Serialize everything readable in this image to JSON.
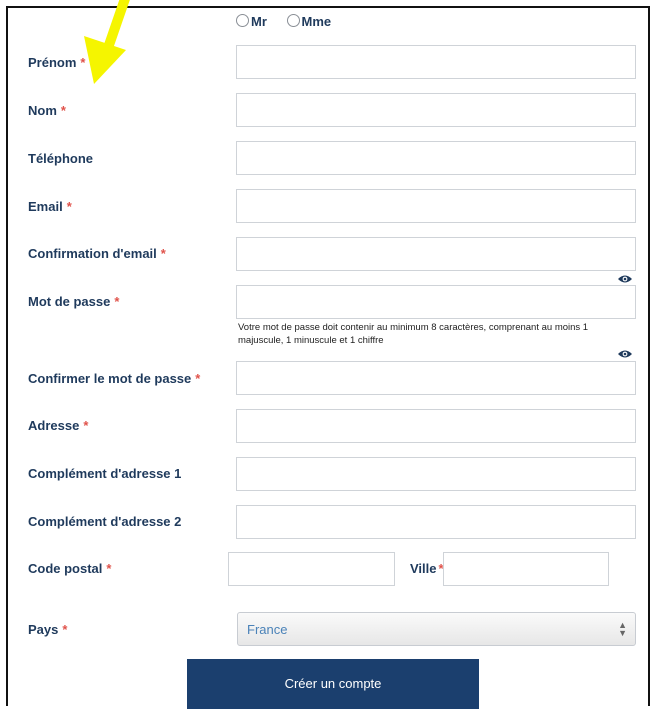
{
  "civility": {
    "options": [
      "Mr",
      "Mme"
    ]
  },
  "required_mark": "*",
  "fields": [
    {
      "label": "Prénom",
      "required": true
    },
    {
      "label": "Nom",
      "required": true
    },
    {
      "label": "Téléphone",
      "required": false
    },
    {
      "label": "Email",
      "required": true
    },
    {
      "label": "Confirmation d'email",
      "required": true
    },
    {
      "label": "Mot de passe",
      "required": true
    },
    {
      "label": "Confirmer le mot de passe",
      "required": true
    },
    {
      "label": "Adresse",
      "required": true
    },
    {
      "label": "Complément d'adresse 1",
      "required": false
    },
    {
      "label": "Complément d'adresse 2",
      "required": false
    }
  ],
  "password_hint": "Votre mot de passe doit contenir au minimum 8 caractères, comprenant au moins 1 majuscule, 1 minuscule et 1 chiffre",
  "postal_code": {
    "label": "Code postal",
    "required": true
  },
  "city": {
    "label": "Ville",
    "required": true
  },
  "country": {
    "label": "Pays",
    "required": true,
    "value": "France"
  },
  "submit_label": "Créer un compte",
  "colors": {
    "label": "#1f3a5c",
    "required": "#e0524a",
    "button": "#1b3f6e",
    "arrow": "#f5f500",
    "select_text": "#4a82b8"
  },
  "icons": {
    "eye": "eye-icon",
    "select": "select-arrows-icon",
    "annotation": "yellow-arrow"
  }
}
